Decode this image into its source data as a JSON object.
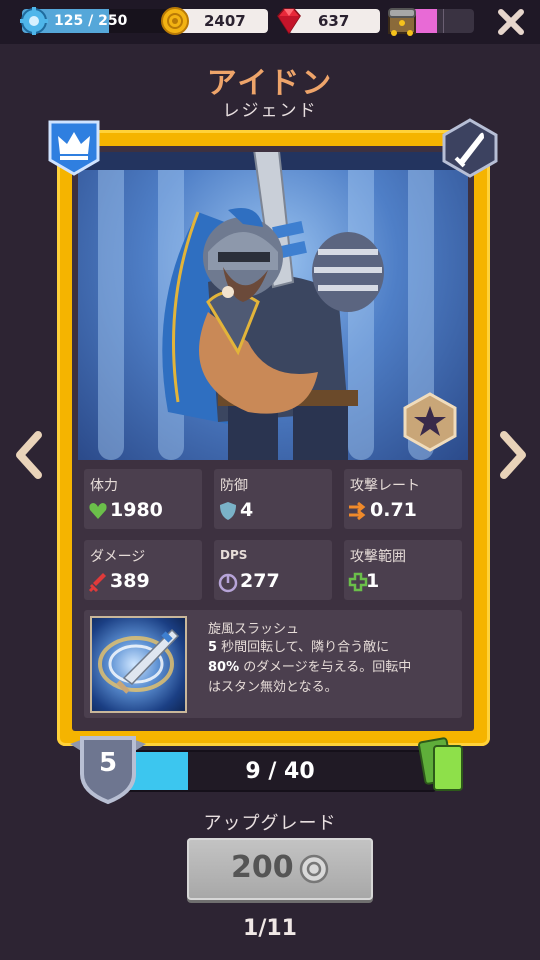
{
  "resources": {
    "xp": {
      "text": "125 / 250",
      "progress": 0.5,
      "icon": "gear-xp-icon"
    },
    "coins": {
      "value": "2407",
      "icon": "coin-icon"
    },
    "gems": {
      "value": "637",
      "icon": "ruby-icon"
    },
    "chest": {
      "icon": "treasure-chest-icon",
      "progress": 0.4
    }
  },
  "hero": {
    "name": "アイドン",
    "rarity": "レジェンド",
    "class_icon": "crown-icon",
    "weapon_icon": "sword-icon",
    "rank_icon": "star-icon"
  },
  "stats": [
    {
      "label": "体力",
      "value": "1980",
      "icon": "heart-icon"
    },
    {
      "label": "防御",
      "value": "4",
      "icon": "shield-icon"
    },
    {
      "label": "攻撃レート",
      "value": "0.71",
      "icon": "arrows-icon"
    },
    {
      "label": "ダメージ",
      "value": "389",
      "icon": "sword-icon"
    },
    {
      "label": "DPS",
      "value": "277",
      "icon": "dps-icon"
    },
    {
      "label": "攻撃範囲",
      "value": "1",
      "icon": "range-cross-icon"
    }
  ],
  "ability": {
    "name": "旋風スラッシュ",
    "desc_line1_bold": "5",
    "desc_line1": " 秒間回転して、隣り合う敵に",
    "desc_line2_bold": "80%",
    "desc_line2": " のダメージを与える。回転中",
    "desc_line3": "はスタン無効となる。"
  },
  "level": {
    "value": "5",
    "cards_text": "9 / 40",
    "progress": 0.225
  },
  "upgrade": {
    "label": "アップグレード",
    "cost": "200"
  },
  "pager": "1/11",
  "colors": {
    "background": "#2d2433",
    "card_gold": "#f5b400",
    "title_orange": "#eea46a",
    "progress_cyan": "#3cc6ef"
  }
}
